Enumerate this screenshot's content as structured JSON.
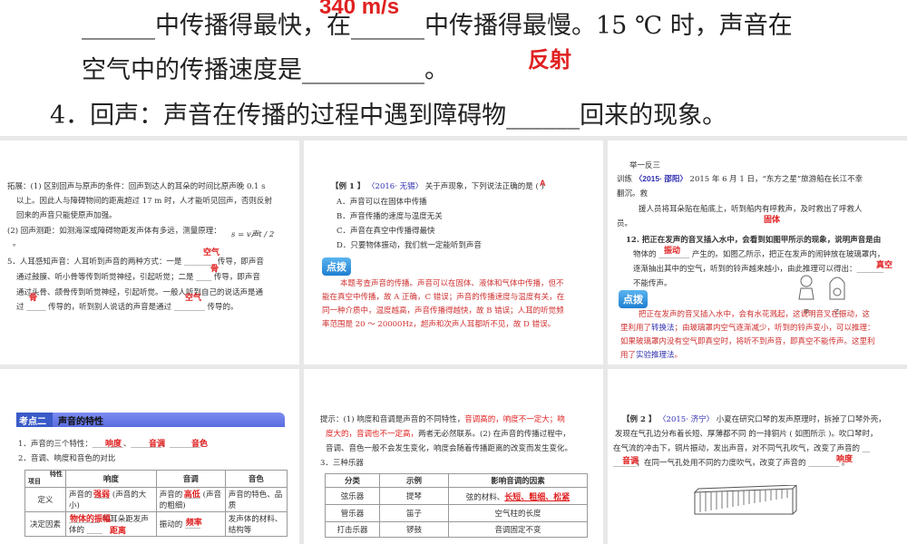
{
  "top_slide": {
    "line1": "______中传播得最快，在______中传播得最慢。15 ℃ 时，声音在",
    "line2": "空气中的传播速度是__________。",
    "line3": "4．回声：声音在传播的过程中遇到障碍物______回来的现象。",
    "answer_speed": "340 m/s",
    "answer_reflect": "反射"
  },
  "slide1": {
    "lines": [
      "拓展：(1) 区别回声与原声的条件：回声到达人的耳朵的时间比原声晚 0.1 s",
      "以上。因此人与障碍物间的距离超过 17 m 时，人才能听见回声，否则反射",
      "回来的声音只能使原声加强。",
      "(2) 回声测距：如测海深或障碍物距发声体有多远，测量原理：",
      "。",
      "5．人耳感知声音：人耳听到声音的两种方式：一是 ________ 传导，即声音",
      "通过鼓膜、听小骨等传到听觉神经，引起听觉；二是 ____ 传导，即声音",
      "通过头骨、颌骨传到听觉神经，引起听觉。一般人听到自己的说话声是通",
      "过 _____ 传导的，听到别人说话的声音是通过 ________ 传导的。"
    ],
    "formula": "s = v声t / 2",
    "answers": [
      "空气",
      "骨",
      "骨",
      "空气"
    ]
  },
  "slide2": {
    "title_prefix": "【例 1 】",
    "source": "〈2016· 无锡〉",
    "question": "关于声现象，下列说法正确的是 (      )",
    "answer": "A",
    "options": [
      "A．声音可以在固体中传播",
      "B．声音传播的速度与温度无关",
      "C．声音在真空中传播得最快",
      "D．只要物体振动，我们就一定能听到声音"
    ],
    "badge": "点拨",
    "explanation": [
      "本题考查声音的传播。声音可以在固体、液体和气体中传播，但不",
      "能在真空中传播，故 A 正确，C 错误；声音的传播速度与温度有关，在",
      "同一种介质中，温度越高，声音传播得越快，故 B 错误；人耳的听觉频",
      "率范围是 20 ～ 20000Hz，超声和次声人耳都听不见，故 D 错误。"
    ]
  },
  "slide3": {
    "heading": "举一反三",
    "label": "训练",
    "source": "〈2015· 邵阳〉",
    "lines": [
      "2015 年 6 月 1 日，“东方之星”旅游船在长江不幸",
      "翻沉。救",
      "援人员将耳朵贴在船底上，听到船内有呼救声，及时救出了呼救人",
      "员。"
    ],
    "answer_solid": "固体",
    "q12": [
      "12. 把正在发声的音叉插入水中，会看到如图甲所示的现象，说明声音是由",
      "物体的 ________ 产生的。如图乙所示，把正在发声的闹钟放在玻璃罩内，",
      "逐渐抽出其中的空气，听到的铃声越来越小，由此推理可以得出：_______",
      "不能传声。"
    ],
    "answers": [
      "振动",
      "真空"
    ],
    "fig_labels": [
      "甲",
      "乙"
    ],
    "badge": "点拨",
    "explanation": [
      "把正在发声的音叉插入水中，会有水花溅起，这说明音叉在振动，这",
      "里利用了",
      "转换法",
      "；由玻璃罩内空气逐渐减少，听到的铃声变小，可以推理：",
      "如果玻璃罩内没有空气即真空时，将听不到声音，即真空不能传声。这里利",
      "用了",
      "实验推理法",
      "。"
    ]
  },
  "slide4": {
    "tag": "考点二",
    "title": "声音的特性",
    "line1": "1．声音的三个特性：________、________、________。",
    "line1_answers": [
      "响度",
      "音调",
      "音色"
    ],
    "line2": "2．音调、响度和音色的对比",
    "table": {
      "corner_top": "特性",
      "corner_bottom": "项目",
      "headers": [
        "响度",
        "音调",
        "音色"
      ],
      "rows": [
        {
          "label": "定义",
          "cells": [
            "声音的 ____ (声音的大小)",
            "声音的 ____ (声音的粗细)",
            "声音的特色、品质"
          ],
          "answers": [
            "强弱",
            "高低"
          ]
        },
        {
          "label": "决定因素",
          "cells": [
            "________ 和耳朵距发声体的 ____",
            "振动的 ____",
            "发声体的材料、结构等"
          ],
          "answers": [
            "物体的振幅",
            "距离",
            "频率"
          ]
        }
      ]
    }
  },
  "slide5": {
    "hint": [
      "提示：(1) 响度和音调是声音的不同特性，",
      "音调高的，响度不一定大；响",
      "度大的，音调也不一定高，",
      "两者无必然联系。(2) 在声音的传播过程中，",
      "音调、音色一般不会发生变化，响度会随着传播距离的改变而发生变化。"
    ],
    "line3": "3．三种乐器",
    "table": {
      "headers": [
        "分类",
        "示例",
        "影响音调的因素"
      ],
      "rows": [
        [
          "弦乐器",
          "提琴",
          "弦的材料、"
        ],
        [
          "管乐器",
          "笛子",
          "空气柱的长度"
        ],
        [
          "打击乐器",
          "锣鼓",
          "音调固定不变"
        ]
      ],
      "answer": "长短、粗细、松紧"
    }
  },
  "slide6": {
    "title_prefix": "【例 2 】",
    "source": "〈2015· 济宁〉",
    "lines": [
      "小夏在研究口琴的发声原理时，拆掉了口琴外壳，",
      "发现在气孔边分布着长短、厚薄都不同 的一排铜片 ( 如图所示 )。吹口琴时，",
      "在气流的冲击下，铜片振动，发出声音，对不同气孔吹气，改变了声音的 __",
      "______；在同一气孔处用不同的力度吹气，改变了声音的 ________ 。"
    ],
    "answers": [
      "音调",
      "响度"
    ]
  }
}
